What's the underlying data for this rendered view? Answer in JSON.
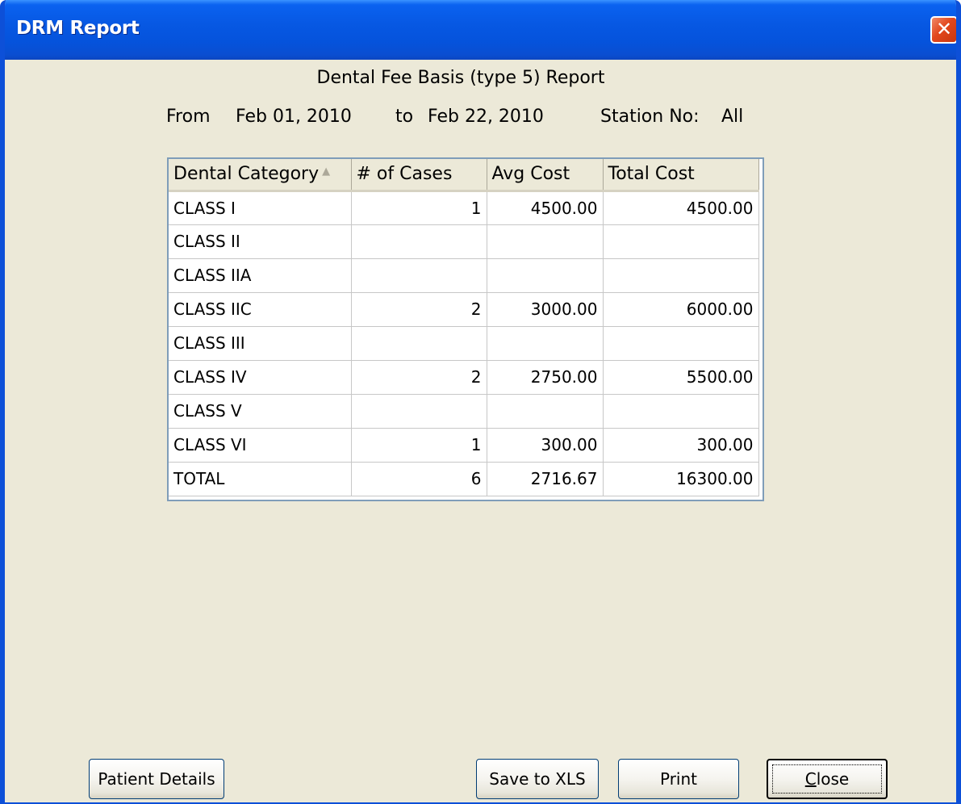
{
  "window": {
    "title": "DRM Report"
  },
  "report": {
    "title": "Dental Fee Basis (type 5) Report",
    "from_label": "From",
    "from_date": "Feb 01, 2010",
    "to_label": "to",
    "to_date": "Feb 22, 2010",
    "station_label": "Station No:",
    "station_value": "All"
  },
  "table": {
    "columns": [
      "Dental Category",
      "# of Cases",
      "Avg Cost",
      "Total Cost"
    ],
    "sorted_column": "Dental Category",
    "rows": [
      {
        "category": "CLASS I",
        "cases": "1",
        "avg": "4500.00",
        "total": "4500.00"
      },
      {
        "category": "CLASS II",
        "cases": "",
        "avg": "",
        "total": ""
      },
      {
        "category": "CLASS IIA",
        "cases": "",
        "avg": "",
        "total": ""
      },
      {
        "category": "CLASS IIC",
        "cases": "2",
        "avg": "3000.00",
        "total": "6000.00"
      },
      {
        "category": "CLASS III",
        "cases": "",
        "avg": "",
        "total": ""
      },
      {
        "category": "CLASS IV",
        "cases": "2",
        "avg": "2750.00",
        "total": "5500.00"
      },
      {
        "category": "CLASS V",
        "cases": "",
        "avg": "",
        "total": ""
      },
      {
        "category": "CLASS VI",
        "cases": "1",
        "avg": "300.00",
        "total": "300.00"
      },
      {
        "category": "TOTAL",
        "cases": "6",
        "avg": "2716.67",
        "total": "16300.00"
      }
    ]
  },
  "buttons": {
    "patient_details": "Patient Details",
    "save_xls": "Save to XLS",
    "print": "Print",
    "close_mnemonic": "C",
    "close_rest": "lose"
  },
  "icons": {
    "close": "close-icon"
  },
  "colors": {
    "titlebar": "#0553dc",
    "face": "#ece9d8",
    "close_button": "#e2471c"
  }
}
